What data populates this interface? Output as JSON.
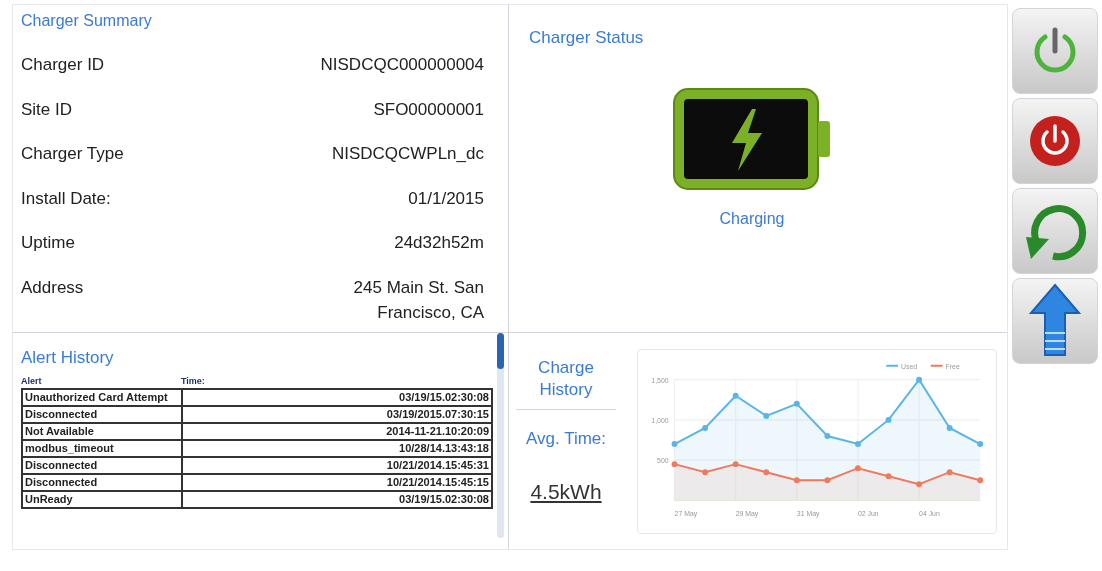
{
  "summary": {
    "title": "Charger Summary",
    "fields": [
      {
        "label": "Charger ID",
        "value": "NISDCQC000000004"
      },
      {
        "label": "Site ID",
        "value": "SFO00000001"
      },
      {
        "label": "Charger Type",
        "value": "NISDCQCWPLn_dc"
      },
      {
        "label": "Install Date:",
        "value": "01/1/2015"
      },
      {
        "label": "Uptime",
        "value": "24d32h52m"
      },
      {
        "label": "Address",
        "value": "245 Main St. San Francisco, CA"
      }
    ]
  },
  "status": {
    "title": "Charger Status",
    "state": "Charging"
  },
  "alerts": {
    "title": "Alert History",
    "columns": [
      "Alert",
      "Time:"
    ],
    "rows": [
      {
        "alert": "Unauthorized Card Attempt",
        "time": "03/19/15.02:30:08"
      },
      {
        "alert": "Disconnected",
        "time": "03/19/2015.07:30:15"
      },
      {
        "alert": "Not Available",
        "time": "2014-11-21.10:20:09"
      },
      {
        "alert": "modbus_timeout",
        "time": "10/28/14.13:43:18"
      },
      {
        "alert": "Disconnected",
        "time": "10/21/2014.15:45:31"
      },
      {
        "alert": "Disconnected",
        "time": "10/21/2014.15:45:15"
      },
      {
        "alert": "UnReady",
        "time": "03/19/15.02:30:08"
      }
    ]
  },
  "history": {
    "title": "Charge History",
    "avg_label": "Avg. Time:",
    "avg_value": "4.5kWh",
    "chart_data": {
      "type": "area",
      "categories": [
        "27 May",
        null,
        "29 May",
        null,
        "31 May",
        null,
        "02 Jun",
        null,
        "04 Jun",
        null,
        null
      ],
      "series": [
        {
          "name": "Used",
          "color": "#5ab4e5",
          "values": [
            700,
            900,
            1300,
            1050,
            1200,
            800,
            700,
            1000,
            1500,
            900,
            700
          ]
        },
        {
          "name": "Free",
          "color": "#ee7b5f",
          "values": [
            450,
            350,
            450,
            350,
            250,
            250,
            400,
            300,
            200,
            350,
            250
          ]
        }
      ],
      "legend": "top-right",
      "ylim": [
        0,
        1500
      ],
      "yticks": [
        {
          "value": 500,
          "label": "500"
        },
        {
          "value": 1000,
          "label": "1,000"
        },
        {
          "value": 1500,
          "label": "1,500"
        }
      ]
    }
  },
  "actions": [
    {
      "kind": "power_on"
    },
    {
      "kind": "power_off"
    },
    {
      "kind": "reset"
    },
    {
      "kind": "update"
    }
  ]
}
